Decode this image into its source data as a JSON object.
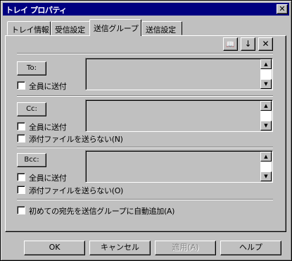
{
  "window": {
    "title": "トレイ プロパティ",
    "close_glyph": "✕"
  },
  "tabs": [
    {
      "label": "トレイ情報"
    },
    {
      "label": "受信設定"
    },
    {
      "label": "送信グループ"
    },
    {
      "label": "送信設定"
    }
  ],
  "toolbar": {
    "book_glyph": "📖",
    "down_glyph": "↓",
    "delete_glyph": "✕"
  },
  "to": {
    "button": "To:",
    "send_all": "全員に送付"
  },
  "cc": {
    "button": "Cc:",
    "send_all": "全員に送付",
    "no_attach": "添付ファイルを送らない(N)"
  },
  "bcc": {
    "button": "Bcc:",
    "send_all": "全員に送付",
    "no_attach": "添付ファイルを送らない(O)"
  },
  "auto_add": "初めての宛先を送信グループに自動追加(A)",
  "scroll": {
    "up": "▲",
    "down": "▼"
  },
  "buttons": {
    "ok": "OK",
    "cancel": "キャンセル",
    "apply": "適用(A)",
    "help": "ヘルプ"
  }
}
